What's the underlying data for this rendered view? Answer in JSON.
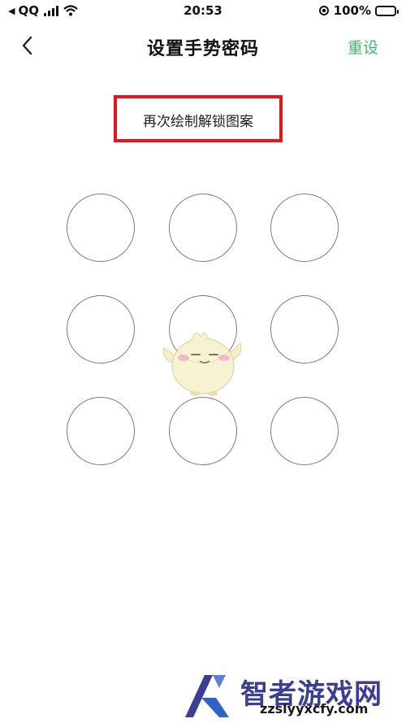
{
  "status_bar": {
    "carrier": "QQ",
    "time": "20:53",
    "battery_percent": "100%"
  },
  "nav": {
    "title": "设置手势密码",
    "reset_label": "重设"
  },
  "prompt": {
    "text": "再次绘制解锁图案",
    "highlight_color": "#e3161c"
  },
  "gesture_pad": {
    "rows": 3,
    "cols": 3
  },
  "watermark": {
    "brand": "智者游戏网",
    "url": "zzslyyxcfy.com"
  },
  "colors": {
    "accent": "#3cba6e",
    "circle_border": "#7c7c7c",
    "watermark_text": "#3a3f93"
  }
}
